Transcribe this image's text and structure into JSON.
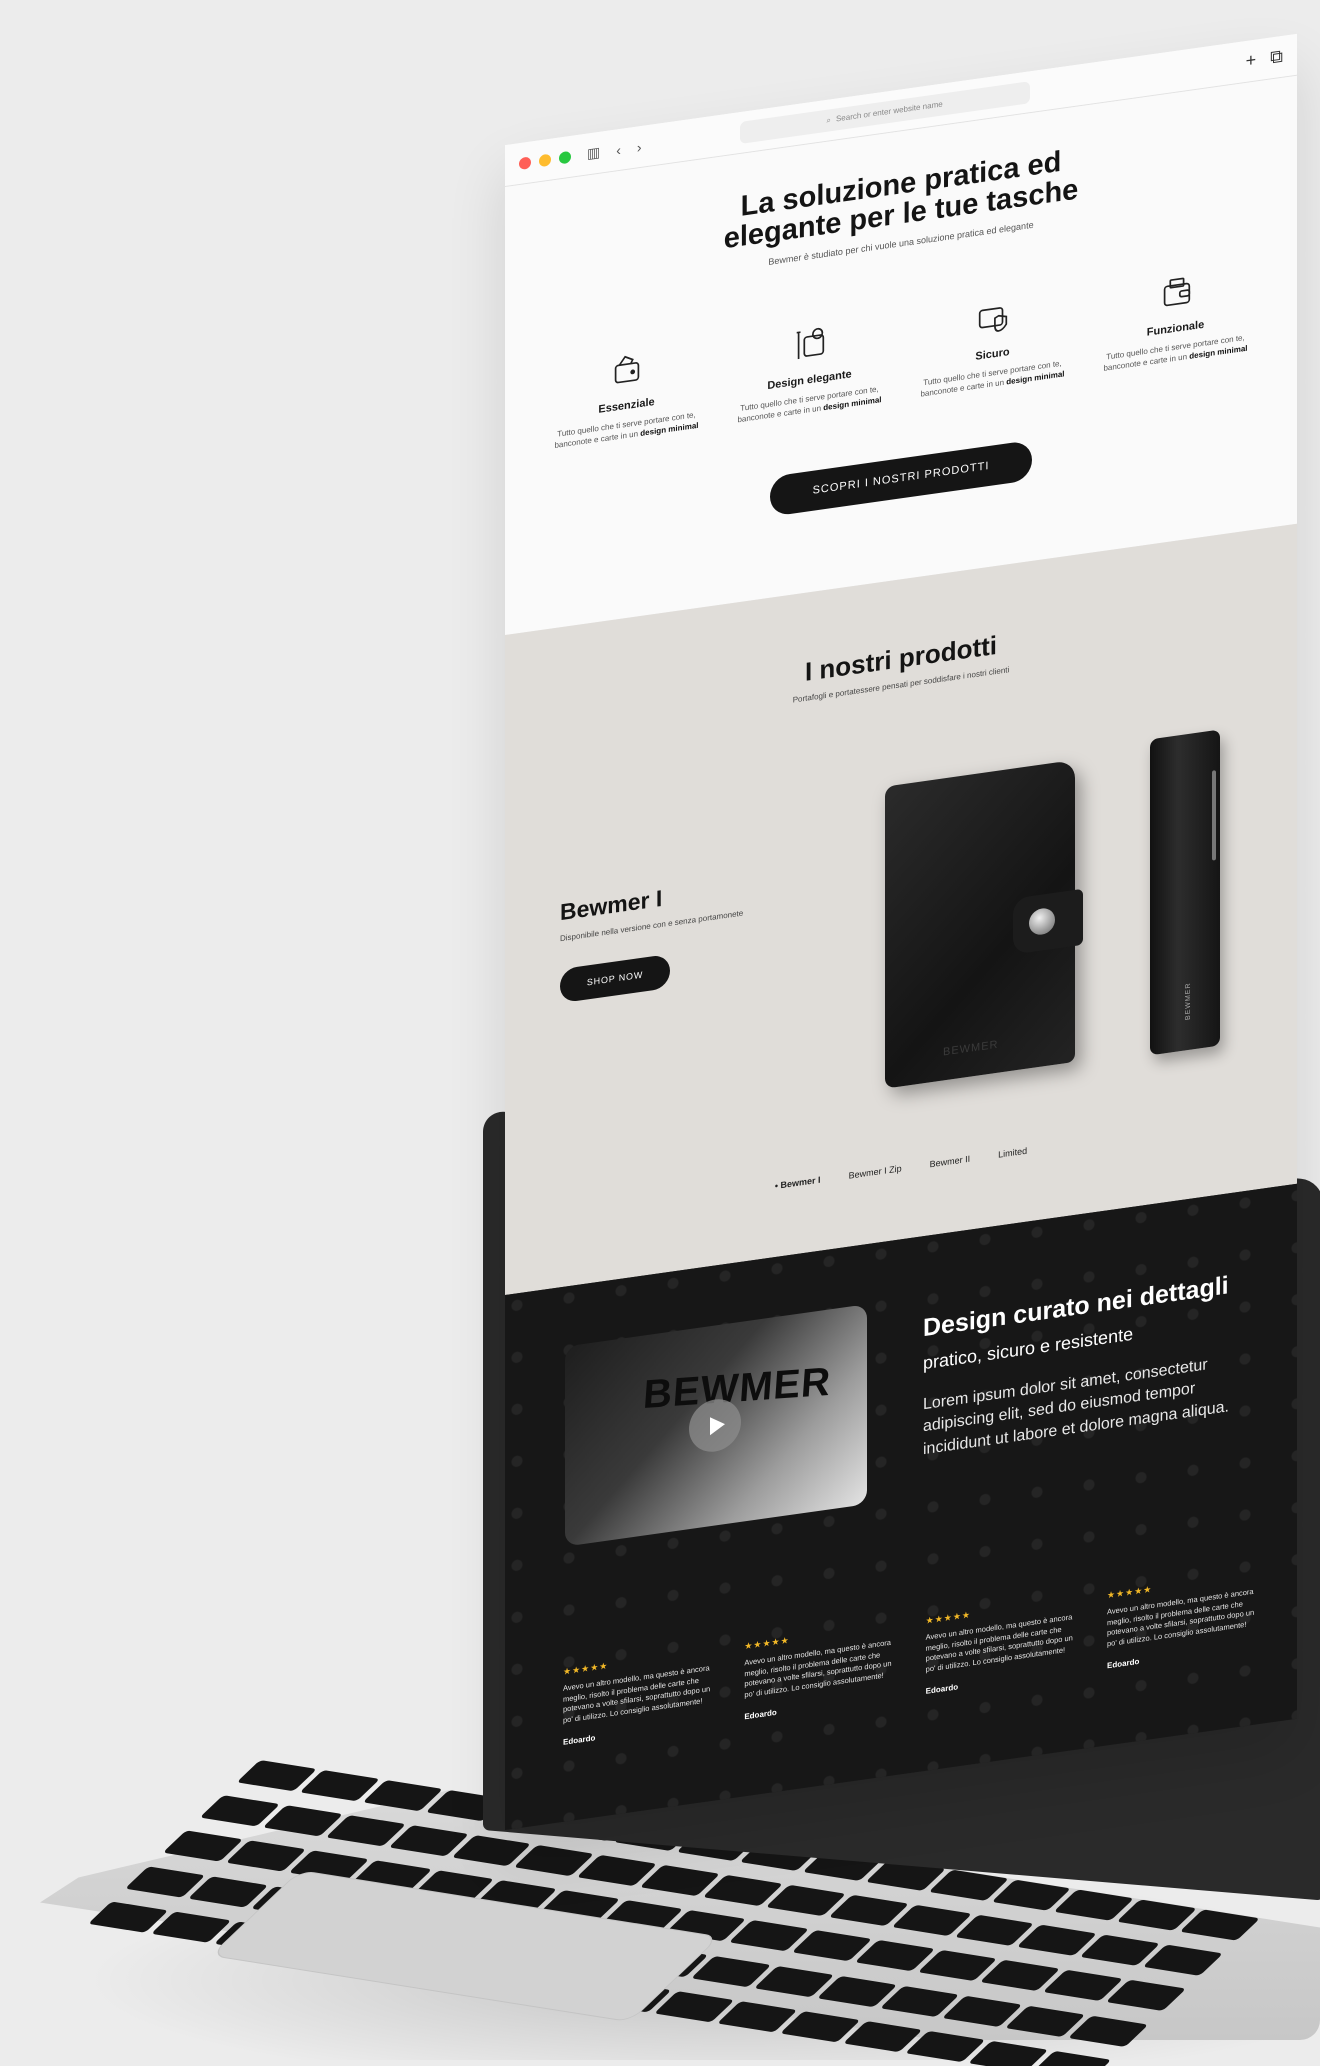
{
  "browser": {
    "address_placeholder": "Search or enter website name",
    "icons": [
      "sidebar-icon",
      "back-icon",
      "forward-icon",
      "search-icon",
      "new-tab-icon",
      "tabs-icon"
    ]
  },
  "hero": {
    "title_line1": "La soluzione pratica ed",
    "title_line2": "elegante per le tue tasche",
    "subtitle": "Bewmer è studiato per chi vuole una soluzione pratica ed elegante",
    "features": [
      {
        "title": "Essenziale",
        "desc": "Tutto quello che ti serve portare con te, banconote e carte in un ",
        "bold": "design minimal",
        "icon": "wallet-cards-icon"
      },
      {
        "title": "Design elegante",
        "desc": "Tutto quello che ti serve portare con te, banconote e carte in un ",
        "bold": "design minimal",
        "icon": "design-pencil-icon"
      },
      {
        "title": "Sicuro",
        "desc": "Tutto quello che ti serve portare con te, banconote e carte in un ",
        "bold": "design minimal",
        "icon": "shield-wallet-icon"
      },
      {
        "title": "Funzionale",
        "desc": "Tutto quello che ti serve portare con te, banconote e carte in un ",
        "bold": "design minimal",
        "icon": "wallet-icon"
      }
    ],
    "cta_label": "SCOPRI I NOSTRI PRODOTTI"
  },
  "products": {
    "title": "I nostri prodotti",
    "subtitle": "Portafogli e portatessere pensati per soddisfare i nostri clienti",
    "current": {
      "name": "Bewmer I",
      "desc": "Disponibile nella versione con e senza portamonete",
      "button": "SHOP NOW"
    },
    "wallet_logo": "BEWMER",
    "variants": [
      "• Bewmer I",
      "Bewmer I Zip",
      "Bewmer II",
      "Limited"
    ]
  },
  "details": {
    "video_logo": "BEWMER",
    "title": "Design curato nei dettagli",
    "subtitle": "pratico, sicuro e resistente",
    "body": "Lorem ipsum dolor sit amet, consectetur adipiscing elit, sed do eiusmod tempor incididunt ut labore et dolore magna aliqua.",
    "reviews": [
      {
        "stars": "★★★★★",
        "text": "Avevo un altro modello, ma questo è ancora meglio, risolto il problema delle carte che potevano a volte sfilarsi, soprattutto dopo un po' di utilizzo. Lo consiglio assolutamente!",
        "author": "Edoardo"
      },
      {
        "stars": "★★★★★",
        "text": "Avevo un altro modello, ma questo è ancora meglio, risolto il problema delle carte che potevano a volte sfilarsi, soprattutto dopo un po' di utilizzo. Lo consiglio assolutamente!",
        "author": "Edoardo"
      },
      {
        "stars": "★★★★★",
        "text": "Avevo un altro modello, ma questo è ancora meglio, risolto il problema delle carte che potevano a volte sfilarsi, soprattutto dopo un po' di utilizzo. Lo consiglio assolutamente!",
        "author": "Edoardo"
      },
      {
        "stars": "★★★★★",
        "text": "Avevo un altro modello, ma questo è ancora meglio, risolto il problema delle carte che potevano a volte sfilarsi, soprattutto dopo un po' di utilizzo. Lo consiglio assolutamente!",
        "author": "Edoardo"
      }
    ]
  },
  "colors": {
    "background": "#ececec",
    "dark": "#171717",
    "products_bg": "#e0ddd9",
    "star": "#f2b827",
    "button": "#151515"
  }
}
